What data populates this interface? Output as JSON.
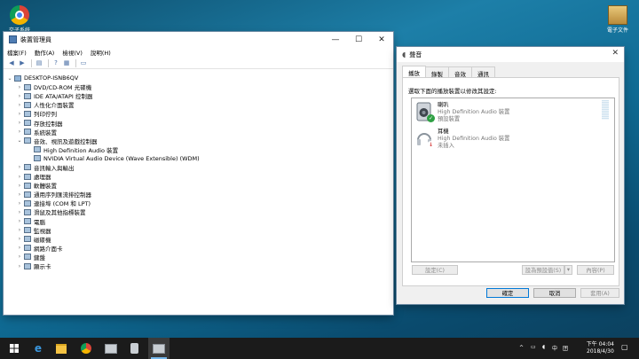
{
  "desktop": {
    "icons": [
      {
        "label": "交子系统",
        "icon": "chrome-icon"
      },
      {
        "label": "電子文件",
        "icon": "documents-icon"
      }
    ]
  },
  "device_manager": {
    "title": "裝置管理員",
    "controls": {
      "minimize": "—",
      "maximize": "☐",
      "close": "✕"
    },
    "menu": [
      "檔案(F)",
      "動作(A)",
      "檢視(V)",
      "說明(H)"
    ],
    "tree": {
      "root": "DESKTOP-ISNB6QV",
      "categories": [
        {
          "label": "DVD/CD-ROM 光碟機",
          "expanded": false
        },
        {
          "label": "IDE ATA/ATAPI 控制器",
          "expanded": false
        },
        {
          "label": "人性化介面裝置",
          "expanded": false
        },
        {
          "label": "列印佇列",
          "expanded": false
        },
        {
          "label": "存放控制器",
          "expanded": false
        },
        {
          "label": "系統裝置",
          "expanded": false
        },
        {
          "label": "音效、視訊及遊戲控制器",
          "expanded": true,
          "children": [
            "High Definition Audio 裝置",
            "NVIDIA Virtual Audio Device (Wave Extensible) (WDM)"
          ]
        },
        {
          "label": "音訊輸入與輸出",
          "expanded": false
        },
        {
          "label": "處理器",
          "expanded": false
        },
        {
          "label": "軟體裝置",
          "expanded": false
        },
        {
          "label": "通用序列匯流排控制器",
          "expanded": false
        },
        {
          "label": "連接埠 (COM 和 LPT)",
          "expanded": false
        },
        {
          "label": "滑鼠及其他指標裝置",
          "expanded": false
        },
        {
          "label": "電腦",
          "expanded": false
        },
        {
          "label": "監視器",
          "expanded": false
        },
        {
          "label": "磁碟機",
          "expanded": false
        },
        {
          "label": "網路介面卡",
          "expanded": false
        },
        {
          "label": "鍵盤",
          "expanded": false
        },
        {
          "label": "顯示卡",
          "expanded": false
        }
      ]
    }
  },
  "sound": {
    "title": "聲音",
    "tabs": [
      "播放",
      "錄製",
      "音效",
      "通訊"
    ],
    "active_tab": "播放",
    "prompt": "選取下面的播放裝置以修改其設定:",
    "devices": [
      {
        "name": "喇叭",
        "driver": "High Definition Audio 裝置",
        "status": "預設裝置",
        "badge": "✓",
        "badge_color": "#2ea043"
      },
      {
        "name": "耳機",
        "driver": "High Definition Audio 裝置",
        "status": "未插入",
        "badge": "↓",
        "badge_color": "#d32f2f"
      }
    ],
    "buttons": {
      "configure": "設定(C)",
      "set_default": "設為預設值(S)",
      "dropdown": "▾",
      "properties": "內容(P)",
      "ok": "確定",
      "cancel": "取消",
      "apply": "套用(A)"
    }
  },
  "taskbar": {
    "start_icon": "windows-start-icon",
    "apps": [
      "edge-icon",
      "file-explorer-icon",
      "chrome-icon",
      "device-app-icon",
      "speaker-app-icon",
      "device-manager-app-icon"
    ],
    "tray": {
      "expand": "^",
      "ime": "中",
      "ime2": "囝"
    },
    "time": "下午 04:04",
    "date": "2018/4/30"
  }
}
